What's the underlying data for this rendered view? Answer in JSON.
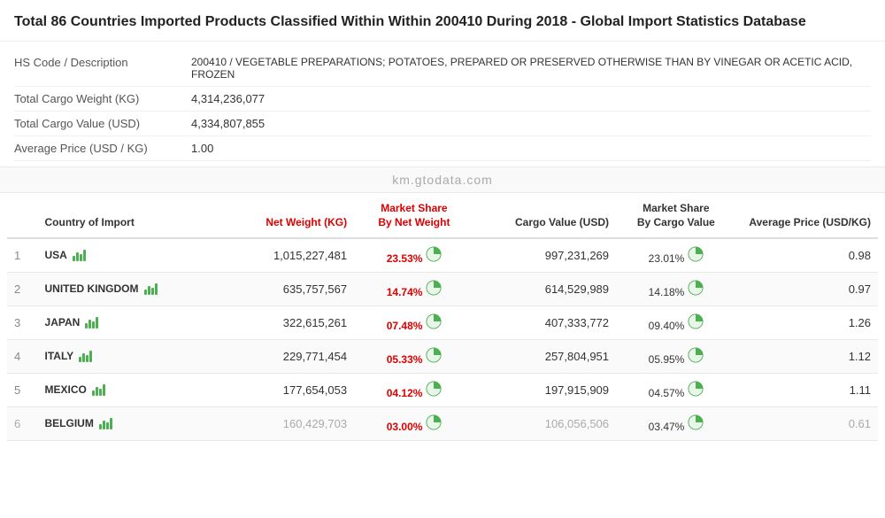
{
  "header": {
    "title_part1": "Total 86 Countries Imported Products Classified Within Within 200410 During 2018",
    "title_part2": " - Global Import Statistics Database"
  },
  "info_rows": [
    {
      "label": "HS Code / Description",
      "value": "200410 / VEGETABLE PREPARATIONS; POTATOES, PREPARED OR PRESERVED OTHERWISE THAN BY VINEGAR OR ACETIC ACID, FROZEN"
    },
    {
      "label": "Total Cargo Weight (KG)",
      "value": "4,314,236,077"
    },
    {
      "label": "Total Cargo Value (USD)",
      "value": "4,334,807,855"
    },
    {
      "label": "Average Price (USD / KG)",
      "value": "1.00"
    }
  ],
  "watermark": "km.gtodata.com",
  "table": {
    "columns": [
      {
        "id": "num",
        "label": "#",
        "redHeader": false
      },
      {
        "id": "country",
        "label": "Country of Import",
        "redHeader": false
      },
      {
        "id": "net_weight",
        "label": "Net Weight (KG)",
        "redHeader": true
      },
      {
        "id": "market_share_weight",
        "label": "Market Share By Net Weight",
        "redHeader": true
      },
      {
        "id": "cargo_value",
        "label": "Cargo Value (USD)",
        "redHeader": false
      },
      {
        "id": "market_share_value",
        "label": "Market Share By Cargo Value",
        "redHeader": false
      },
      {
        "id": "avg_price",
        "label": "Average Price (USD/KG)",
        "redHeader": false
      }
    ],
    "rows": [
      {
        "num": 1,
        "country": "USA",
        "net_weight": "1,015,227,481",
        "market_share_weight": "23.53%",
        "cargo_value": "997,231,269",
        "market_share_value": "23.01%",
        "avg_price": "0.98"
      },
      {
        "num": 2,
        "country": "UNITED KINGDOM",
        "net_weight": "635,757,567",
        "market_share_weight": "14.74%",
        "cargo_value": "614,529,989",
        "market_share_value": "14.18%",
        "avg_price": "0.97"
      },
      {
        "num": 3,
        "country": "JAPAN",
        "net_weight": "322,615,261",
        "market_share_weight": "07.48%",
        "cargo_value": "407,333,772",
        "market_share_value": "09.40%",
        "avg_price": "1.26"
      },
      {
        "num": 4,
        "country": "ITALY",
        "net_weight": "229,771,454",
        "market_share_weight": "05.33%",
        "cargo_value": "257,804,951",
        "market_share_value": "05.95%",
        "avg_price": "1.12"
      },
      {
        "num": 5,
        "country": "MEXICO",
        "net_weight": "177,654,053",
        "market_share_weight": "04.12%",
        "cargo_value": "197,915,909",
        "market_share_value": "04.57%",
        "avg_price": "1.11"
      },
      {
        "num": 6,
        "country": "BELGIUM",
        "net_weight": "160,429,703",
        "market_share_weight": "03.00%",
        "cargo_value": "106,056,506",
        "market_share_value": "03.47%",
        "avg_price": "0.61"
      }
    ],
    "truncated": true
  }
}
